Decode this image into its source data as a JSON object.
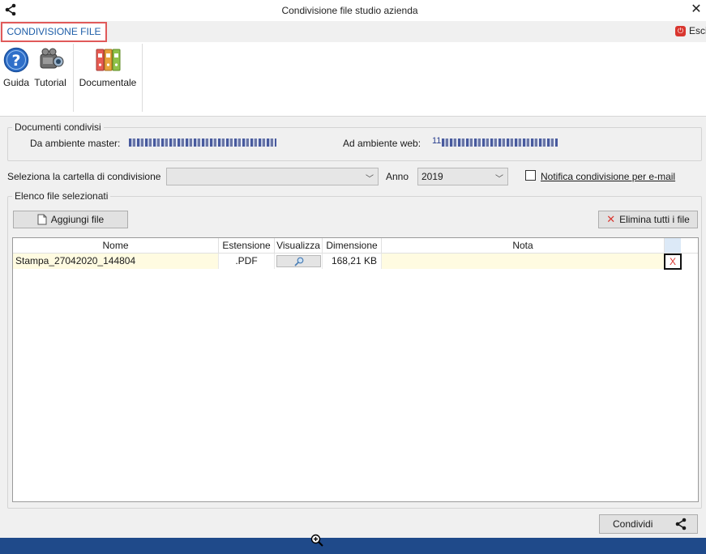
{
  "window": {
    "title": "Condivisione file studio azienda",
    "close_glyph": "✕"
  },
  "ribbon": {
    "tab_label": "CONDIVISIONE FILE",
    "exit_label": "Esci",
    "buttons": [
      {
        "label": "Guida",
        "icon": "help-icon"
      },
      {
        "label": "Tutorial",
        "icon": "camera-icon"
      },
      {
        "label": "Documentale",
        "icon": "binders-icon"
      }
    ]
  },
  "shared_docs": {
    "group_title": "Documenti condivisi",
    "master_label": "Da ambiente master:",
    "web_label": "Ad ambiente web:",
    "web_value_prefix": "11"
  },
  "filters": {
    "folder_label": "Seleziona la cartella di condivisione",
    "folder_value": "",
    "year_label": "Anno",
    "year_value": "2019",
    "notify_label": "Notifica condivisione per e-mail",
    "notify_checked": false
  },
  "file_list": {
    "group_title": "Elenco file selezionati",
    "add_button": "Aggiungi file",
    "delete_all_button": "Elimina tutti i file",
    "columns": [
      "Nome",
      "Estensione",
      "Visualizza",
      "Dimensione",
      "Nota"
    ],
    "rows": [
      {
        "name": "Stampa_27042020_144804",
        "extension": ".PDF",
        "size": "168,21 KB",
        "note": "",
        "delete": "X"
      }
    ]
  },
  "footer": {
    "share_button": "Condividi"
  },
  "colors": {
    "accent": "#1e5ea8",
    "tab_border": "#e05a5a",
    "row_bg": "#fffbe1",
    "status_bar": "#1f4a8a",
    "delete_red": "#d9362f"
  }
}
